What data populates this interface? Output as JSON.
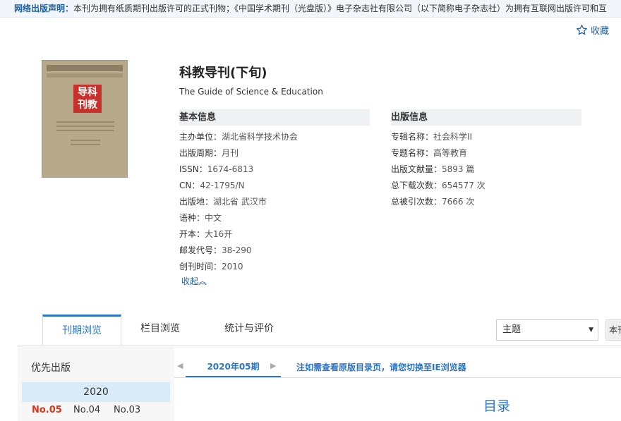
{
  "notice": {
    "label": "网络出版声明：",
    "text": "本刊为拥有纸质期刊出版许可的正式刊物；《中国学术期刊（光盘版）》电子杂志社有限公司（以下简称电子杂志社）为拥有互联网出版许可和互"
  },
  "favorite": {
    "label": "收藏",
    "icon": "star-outline-icon"
  },
  "journal": {
    "title": "科教导刊(下旬)",
    "english_title": "The Guide of Science & Education",
    "cover_logo": "导科刊教"
  },
  "basic_info": {
    "heading": "基本信息",
    "rows": [
      {
        "label": "主办单位：",
        "value": "湖北省科学技术协会"
      },
      {
        "label": "出版周期：",
        "value": "月刊"
      },
      {
        "label": "ISSN：",
        "value": "1674-6813"
      },
      {
        "label": "CN：",
        "value": "42-1795/N"
      },
      {
        "label": "出版地：",
        "value": "湖北省 武汉市"
      },
      {
        "label": "语种：",
        "value": "中文"
      },
      {
        "label": "开本：",
        "value": "大16开"
      },
      {
        "label": "邮发代号：",
        "value": "38-290"
      },
      {
        "label": "创刊时间：",
        "value": "2010"
      }
    ],
    "collapse_label": "收起︽"
  },
  "publish_info": {
    "heading": "出版信息",
    "rows": [
      {
        "label": "专辑名称：",
        "value": "社会科学II"
      },
      {
        "label": "专题名称：",
        "value": "高等教育"
      },
      {
        "label": "出版文献量：",
        "value": "5893 篇"
      },
      {
        "label": "总下载次数：",
        "value": "654577 次"
      },
      {
        "label": "总被引次数：",
        "value": "7666 次"
      }
    ]
  },
  "tabs": [
    {
      "label": "刊期浏览"
    },
    {
      "label": "栏目浏览"
    },
    {
      "label": "统计与评价"
    }
  ],
  "search": {
    "select_value": "主题",
    "stub_label": "本刊"
  },
  "issues_panel": {
    "priority_label": "优先出版",
    "year": "2020",
    "issues": [
      "No.05",
      "No.04",
      "No.03"
    ]
  },
  "issue_view": {
    "current_issue": "2020年05期",
    "ie_tip": "注如需查看原版目录页，请您切换至IE浏览器",
    "toc_title": "目录"
  },
  "colors": {
    "accent": "#2b76c8",
    "active_issue": "#d9361d"
  }
}
